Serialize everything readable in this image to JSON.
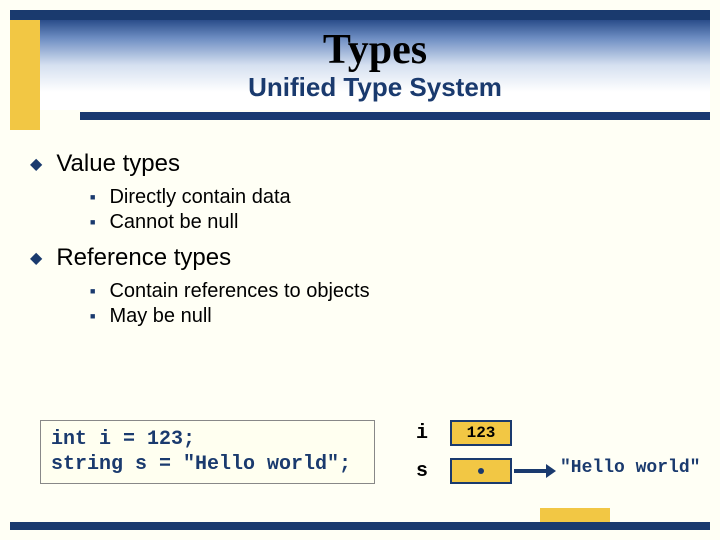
{
  "header": {
    "title": "Types",
    "subtitle": "Unified Type System"
  },
  "bullets": [
    {
      "label": "Value types",
      "subs": [
        "Directly contain data",
        "Cannot be null"
      ]
    },
    {
      "label": "Reference types",
      "subs": [
        "Contain references to objects",
        "May be null"
      ]
    }
  ],
  "code": {
    "line1": "int i = 123;",
    "line2": "string s = \"Hello world\";"
  },
  "diagram": {
    "var_i": "i",
    "var_s": "s",
    "val_i": "123",
    "ref_target": "\"Hello world\""
  }
}
